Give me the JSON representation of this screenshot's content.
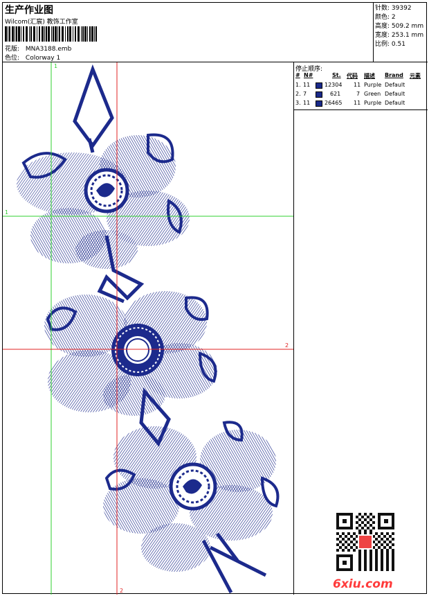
{
  "header": {
    "title": "生产作业图",
    "subtitle": "Wilcom(汇宸) 教饰工作室",
    "design_label": "花版:",
    "design_value": "MNA3188.emb",
    "colorway_label": "色位:",
    "colorway_value": "Colorway 1"
  },
  "stats": [
    {
      "label": "针数:",
      "value": "39392"
    },
    {
      "label": "颜色:",
      "value": "2"
    },
    {
      "label": "高度:",
      "value": "509.2 mm"
    },
    {
      "label": "宽度:",
      "value": "253.1 mm"
    },
    {
      "label": "比例:",
      "value": "0.51"
    }
  ],
  "stop_sequence": {
    "title": "停止顺序:",
    "columns": [
      "#",
      "N#",
      "St.",
      "代码",
      "描述",
      "Brand",
      "元素"
    ],
    "rows": [
      {
        "idx": "1.",
        "needle": "11",
        "color": "#1a2a8a",
        "stitches": "12304",
        "code": "11",
        "desc": "Purple",
        "brand": "Default"
      },
      {
        "idx": "2.",
        "needle": "7",
        "color": "#1a2a8a",
        "stitches": "621",
        "code": "7",
        "desc": "Green",
        "brand": "Default"
      },
      {
        "idx": "3.",
        "needle": "11",
        "color": "#1a2a8a",
        "stitches": "26465",
        "code": "11",
        "desc": "Purple",
        "brand": "Default"
      }
    ]
  },
  "guides": {
    "v1": "1",
    "h1": "1",
    "h2": "2",
    "v2": "2"
  },
  "watermark": "6xiu.com",
  "colors": {
    "thread": "#1c2a8c",
    "guide_green": "#2fd02f",
    "guide_red": "#e02020",
    "brand_red": "#ff3b3b"
  }
}
